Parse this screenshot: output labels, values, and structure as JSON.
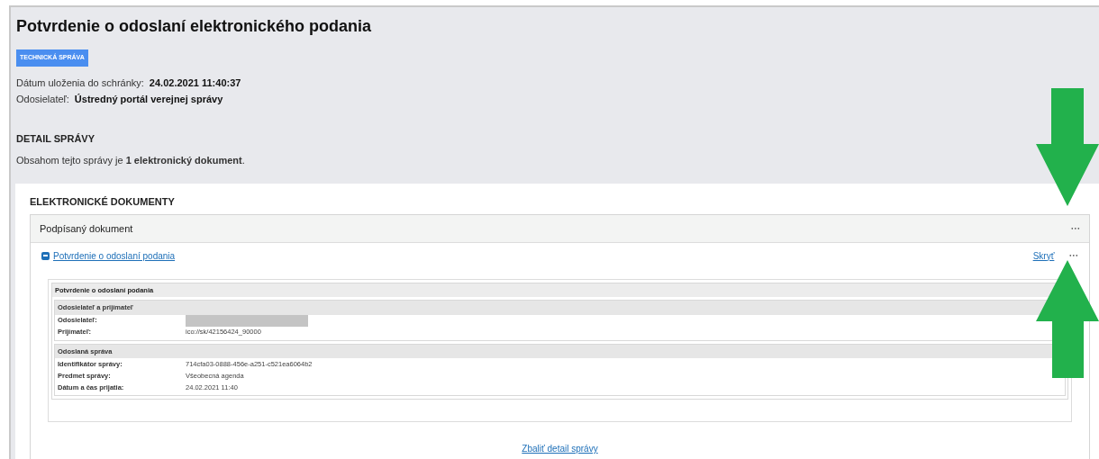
{
  "title": "Potvrdenie o odoslaní elektronického podania",
  "badge": "TECHNICKÁ SPRÁVA",
  "meta": [
    {
      "label": "Dátum uloženia do schránky:",
      "value": "24.02.2021 11:40:37"
    },
    {
      "label": "Odosielateľ:",
      "value": "Ústredný portál verejnej správy"
    }
  ],
  "detail": {
    "heading": "DETAIL SPRÁVY",
    "text": "Obsahom tejto správy je **1 elektronický dokument**."
  },
  "documents": {
    "heading": "ELEKTRONICKÉ DOKUMENTY",
    "group": {
      "title": "Podpísaný dokument",
      "menu": "•••"
    },
    "item": {
      "title": "Potvrdenie o odoslaní podania",
      "expanded": true,
      "hide": "Skryť",
      "menu": "•••"
    },
    "doc": {
      "title": "Potvrdenie o odoslaní podania",
      "sections": [
        {
          "title": "Odosielateľ a prijímateľ",
          "rows": [
            {
              "label": "Odosielateľ:",
              "redacted": true
            },
            {
              "label": "Prijímateľ:",
              "value": "ico://sk/42156424_90000",
              "redacted": false
            }
          ]
        },
        {
          "title": "Odoslaná správa",
          "rows": [
            {
              "label": "Identifikátor správy:",
              "value": "714cfa03-0888-456e-a251-c521ea6064b2",
              "redacted": false
            },
            {
              "label": "Predmet správy:",
              "value": "Všeobecná agenda",
              "redacted": false
            },
            {
              "label": "Dátum a čas prijatia:",
              "value": "24.02.2021 11:40",
              "redacted": false
            }
          ]
        }
      ]
    },
    "collapse": "Zbaliť detail správy"
  },
  "annotations": [
    {
      "kind": "arrow_down"
    },
    {
      "kind": "arrow_up"
    }
  ]
}
